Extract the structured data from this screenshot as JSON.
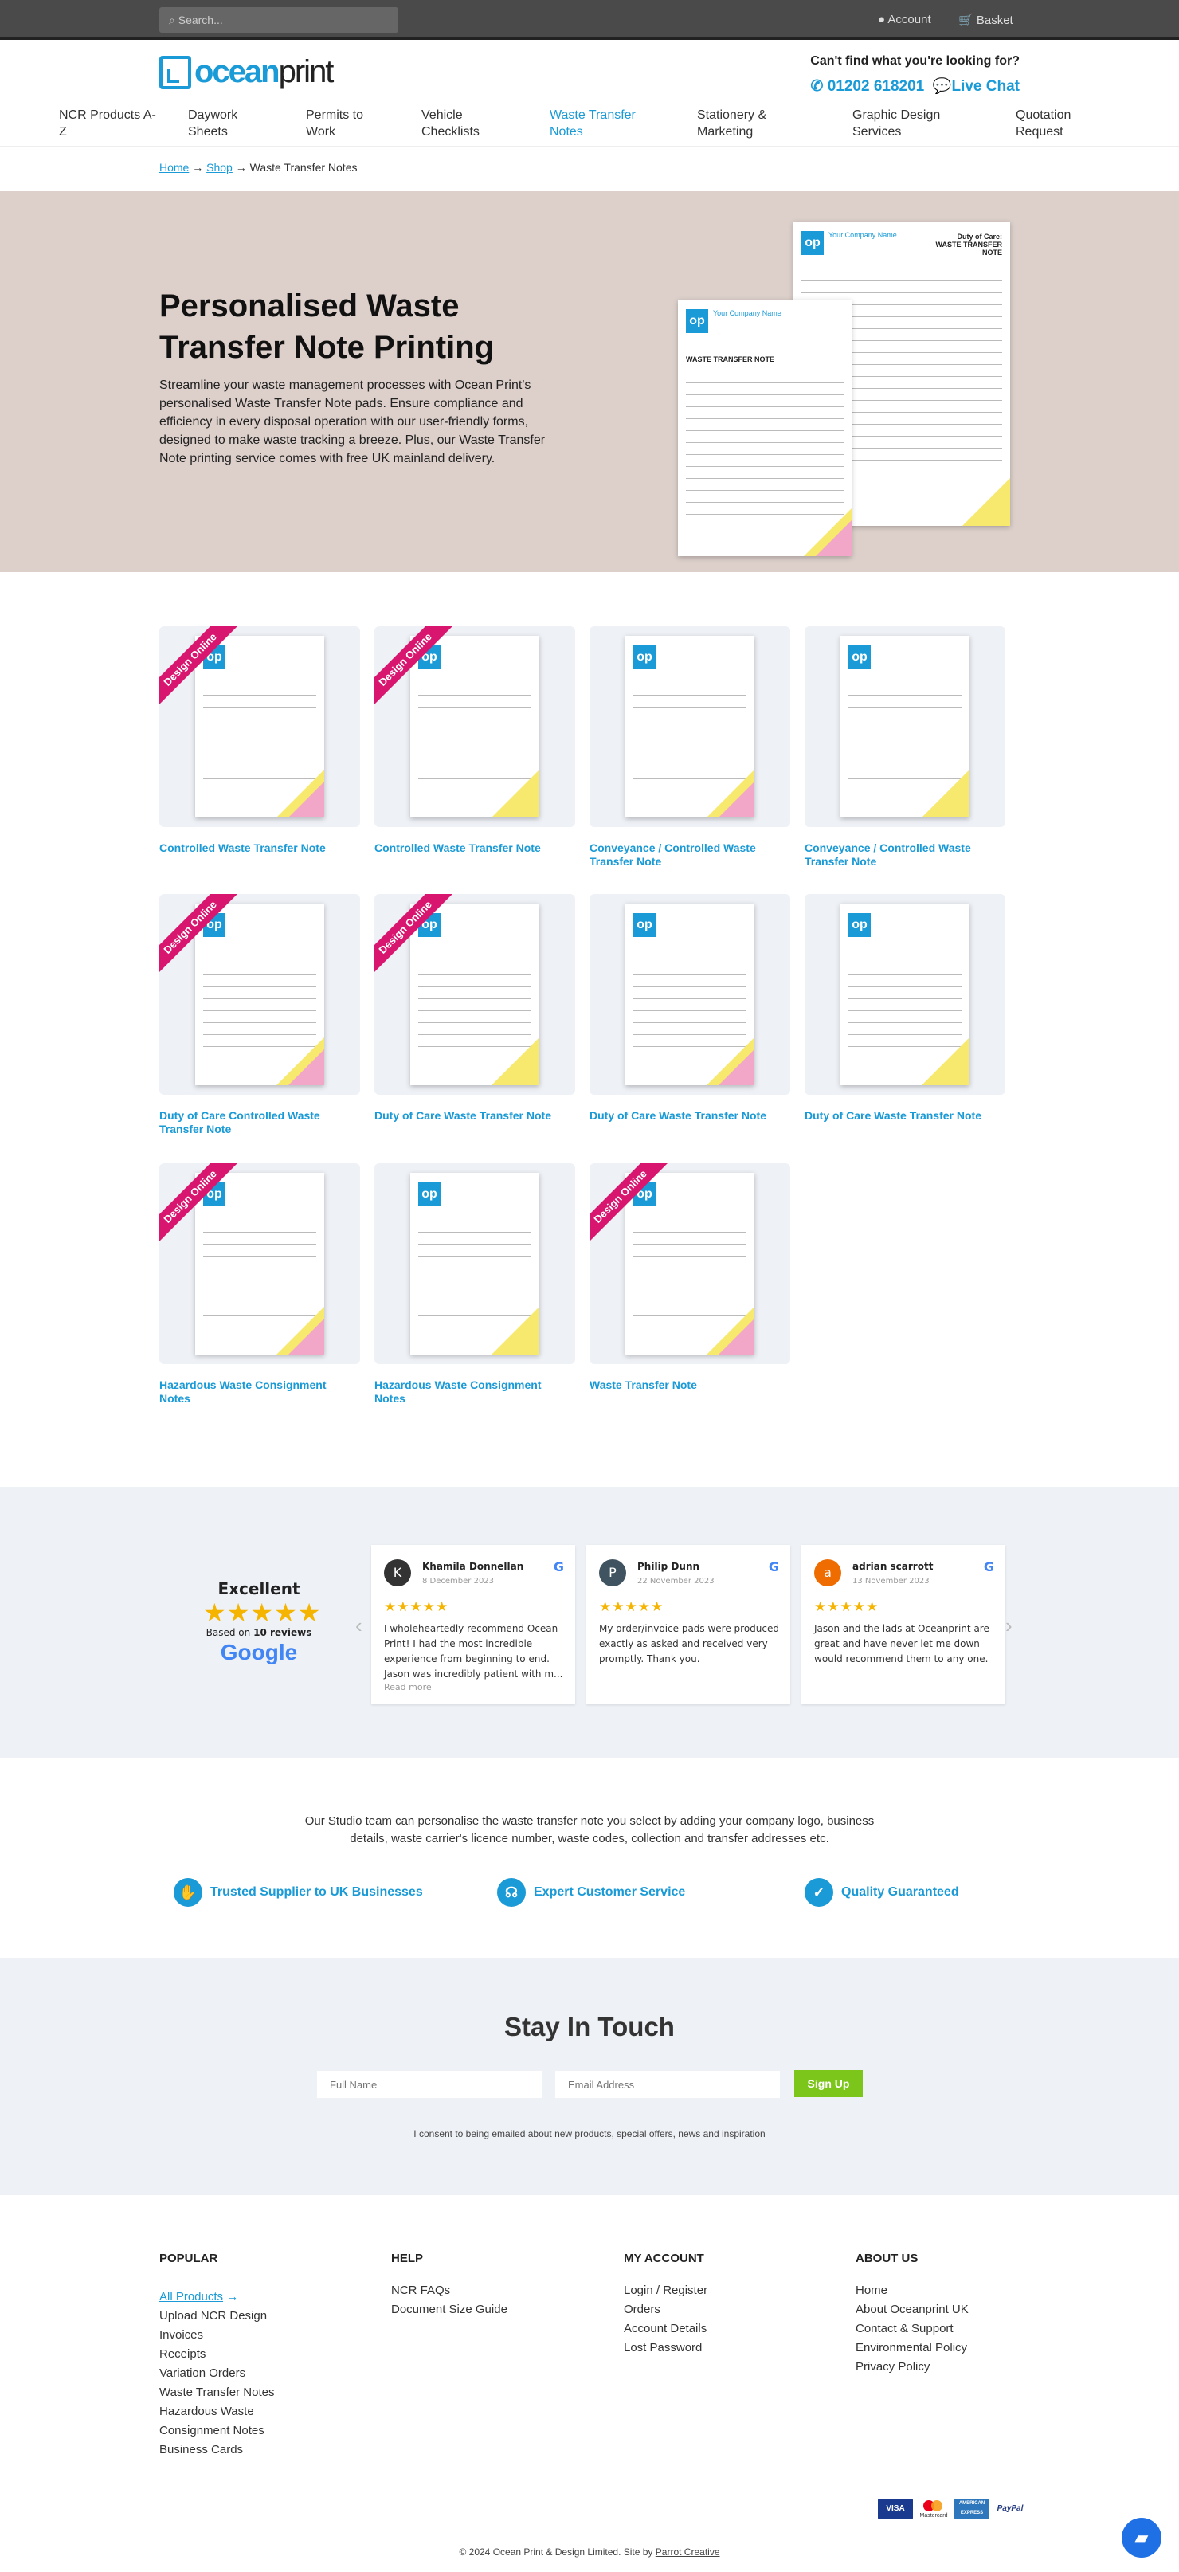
{
  "topbar": {
    "search_placeholder": "Search...",
    "account": "Account",
    "basket": "Basket"
  },
  "brand": {
    "logo_a": "ocean",
    "logo_b": "print",
    "accent": "#1a9ad6"
  },
  "help": {
    "question": "Can't find what you're looking for?",
    "phone": "01202 618201",
    "chat": "Live Chat"
  },
  "nav": [
    {
      "label": "NCR Products A-Z"
    },
    {
      "label": "Daywork Sheets"
    },
    {
      "label": "Permits to Work"
    },
    {
      "label": "Vehicle Checklists"
    },
    {
      "label": "Waste Transfer Notes",
      "active": true
    },
    {
      "label": "Stationery & Marketing"
    },
    {
      "label": "Graphic Design Services"
    },
    {
      "label": "Quotation Request"
    }
  ],
  "breadcrumb": {
    "home": "Home",
    "shop": "Shop",
    "current": "Waste Transfer Notes"
  },
  "hero": {
    "title": "Personalised Waste Transfer Note Printing",
    "text": "Streamline your waste management processes with Ocean Print's personalised Waste Transfer Note pads. Ensure compliance and efficiency in every disposal operation with our user-friendly forms, designed to make waste tracking a breeze. Plus, our Waste Transfer Note printing service comes with free UK mainland delivery.",
    "sheet_company": "Your Company Name",
    "sheet_title_a": "WASTE TRANSFER NOTE",
    "sheet_title_b": "Duty of Care: WASTE TRANSFER NOTE"
  },
  "products": [
    {
      "title": "Controlled Waste Transfer Note",
      "ribbon": "Design Online"
    },
    {
      "title": "Controlled Waste Transfer Note",
      "ribbon": "Design Online"
    },
    {
      "title": "Conveyance / Controlled Waste Transfer Note"
    },
    {
      "title": "Conveyance / Controlled Waste Transfer Note"
    },
    {
      "title": "Duty of Care Controlled Waste Transfer Note",
      "ribbon": "Design Online"
    },
    {
      "title": "Duty of Care Waste Transfer Note",
      "ribbon": "Design Online"
    },
    {
      "title": "Duty of Care Waste Transfer Note"
    },
    {
      "title": "Duty of Care Waste Transfer Note"
    },
    {
      "title": "Hazardous Waste Consignment Notes",
      "ribbon": "Design Online"
    },
    {
      "title": "Hazardous Waste Consignment Notes"
    },
    {
      "title": "Waste Transfer Note",
      "ribbon": "Design Online"
    }
  ],
  "reviews": {
    "rating_label": "Excellent",
    "based_on": "Based on",
    "count": "10 reviews",
    "provider": "Google",
    "rating": 5,
    "items": [
      {
        "name": "Khamila Donnellan",
        "date": "8 December 2023",
        "text": "I wholeheartedly recommend Ocean Print! I had the most incredible experience from beginning to end. Jason was incredibly patient with m...",
        "read_more": "Read more",
        "initial": "K",
        "color": "#333333"
      },
      {
        "name": "Philip Dunn",
        "date": "22 November 2023",
        "text": "My order/invoice pads were produced exactly as asked and received very promptly. Thank you.",
        "initial": "P",
        "color": "#3f5360"
      },
      {
        "name": "adrian scarrott",
        "date": "13 November 2023",
        "text": "Jason and the lads at Oceanprint are great and have never let me down would recommend them to any one.",
        "initial": "a",
        "color": "#ef6c00"
      }
    ]
  },
  "studio_text": "Our Studio team can personalise the waste transfer note you select by adding your company logo, business details, waste carrier's licence number, waste codes, collection and transfer addresses etc.",
  "features": [
    {
      "label": "Trusted Supplier to UK Businesses",
      "icon": "handshake-icon"
    },
    {
      "label": "Expert Customer Service",
      "icon": "headset-icon"
    },
    {
      "label": "Quality Guaranteed",
      "icon": "badge-check-icon"
    }
  ],
  "newsletter": {
    "title": "Stay In Touch",
    "name_placeholder": "Full Name",
    "email_placeholder": "Email Address",
    "button": "Sign Up",
    "consent": "I consent to being emailed about new products, special offers, news and inspiration",
    "button_color": "#7cc51a"
  },
  "footer": {
    "popular": {
      "title": "POPULAR",
      "highlight": "All Products",
      "links": [
        "Upload NCR Design",
        "Invoices",
        "Receipts",
        "Variation Orders",
        "Waste Transfer Notes",
        "Hazardous Waste Consignment Notes",
        "Business Cards"
      ]
    },
    "help": {
      "title": "HELP",
      "links": [
        "NCR FAQs",
        "Document Size Guide"
      ]
    },
    "account": {
      "title": "MY ACCOUNT",
      "links": [
        "Login / Register",
        "Orders",
        "Account Details",
        "Lost Password"
      ]
    },
    "about": {
      "title": "ABOUT US",
      "links": [
        "Home",
        "About Oceanprint UK",
        "Contact & Support",
        "Environmental Policy",
        "Privacy Policy"
      ]
    },
    "payments": [
      "VISA",
      "Mastercard",
      "AMERICAN EXPRESS",
      "PayPal"
    ],
    "copyright": "© 2024 Ocean Print & Design Limited. Site by",
    "credit": "Parrot Creative"
  }
}
